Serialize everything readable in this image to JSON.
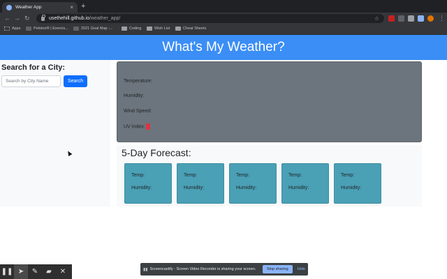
{
  "browser": {
    "tab_title": "Weather App",
    "tab_close": "×",
    "new_tab": "+",
    "url_host": "usethehill.github.io",
    "url_path": "/weather_app/",
    "bookmarks": [
      "Apps",
      "Peloton® | Exercis...",
      "2021 Goal Map -...",
      "Coding",
      "Wish List",
      "Cheat Sheets"
    ]
  },
  "page": {
    "title": "What's My Weather?",
    "sidebar": {
      "heading": "Search for a City:",
      "search_placeholder": "Search by City Name",
      "search_button": "Search"
    },
    "current": {
      "temperature_label": "Temperature:",
      "humidity_label": "Humidity:",
      "wind_label": "Wind Speed:",
      "uv_label": "UV Index:"
    },
    "forecast": {
      "heading": "5-Day Forecast:",
      "cards": [
        {
          "temp_label": "Temp:",
          "humidity_label": "Humidity:"
        },
        {
          "temp_label": "Temp:",
          "humidity_label": "Humidity:"
        },
        {
          "temp_label": "Temp:",
          "humidity_label": "Humidity:"
        },
        {
          "temp_label": "Temp:",
          "humidity_label": "Humidity:"
        },
        {
          "temp_label": "Temp:",
          "humidity_label": "Humidity:"
        }
      ]
    }
  },
  "overlay": {
    "share_text": "Screencastify - Screen Video Recorder is sharing your screen.",
    "stop_button": "Stop sharing",
    "hide_button": "Hide",
    "tools": [
      "pause-icon",
      "cursor-icon",
      "pen-icon",
      "eraser-icon",
      "close-icon"
    ]
  },
  "colors": {
    "header": "#3b8ef5",
    "current_panel": "#6c757d",
    "forecast_card": "#4aa0b5",
    "search_button": "#0d6efd",
    "uv_badge": "#dc3545"
  }
}
